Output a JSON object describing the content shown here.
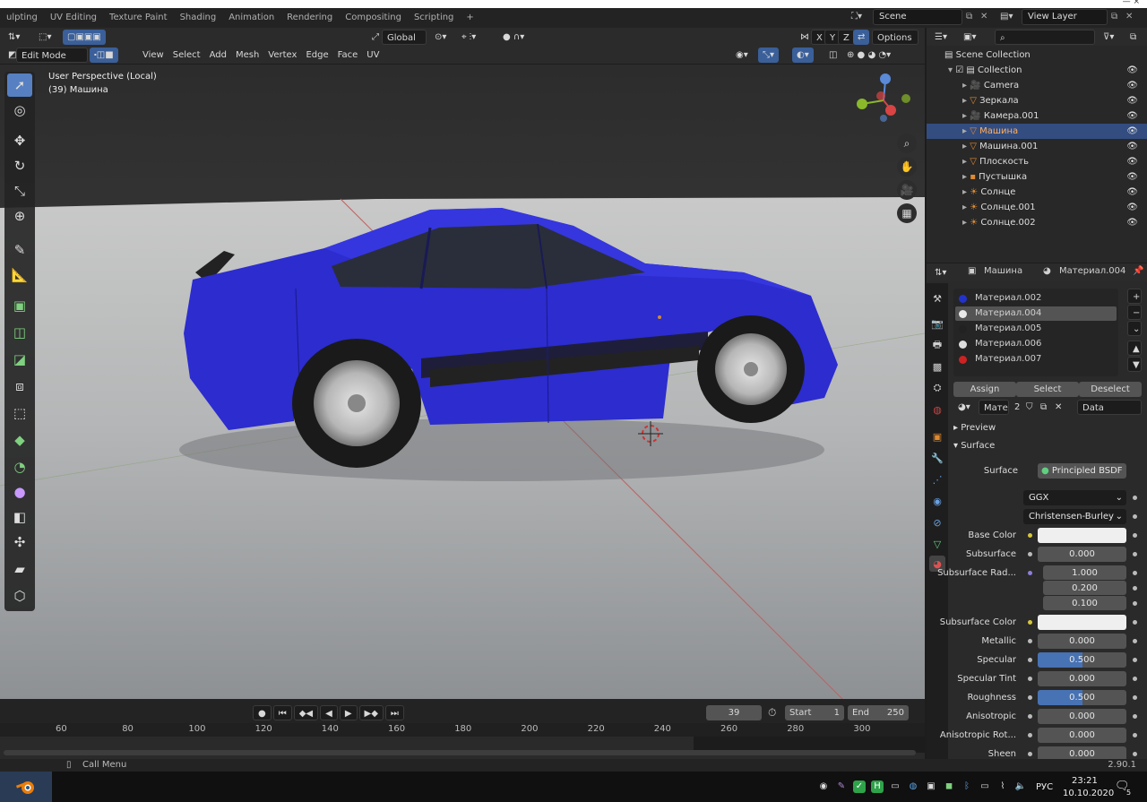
{
  "workspace_tabs": [
    "ulpting",
    "UV Editing",
    "Texture Paint",
    "Shading",
    "Animation",
    "Rendering",
    "Compositing",
    "Scripting",
    "+"
  ],
  "scene": {
    "label": "Scene",
    "view_layer": "View Layer"
  },
  "header": {
    "orientation": "Global",
    "options": "Options",
    "mode": "Edit Mode",
    "menus": [
      "View",
      "Select",
      "Add",
      "Mesh",
      "Vertex",
      "Edge",
      "Face",
      "UV"
    ],
    "axes": [
      "X",
      "Y",
      "Z"
    ]
  },
  "viewport": {
    "line1": "User Perspective (Local)",
    "line2": "(39) Машина"
  },
  "outliner": {
    "root": "Scene Collection",
    "collection": "Collection",
    "items": [
      "Camera",
      "Зеркала",
      "Камера.001",
      "Машина",
      "Машина.001",
      "Плоскость",
      "Пустышка",
      "Солнце",
      "Солнце.001",
      "Солнце.002"
    ],
    "selected": "Машина"
  },
  "properties": {
    "object": "Машина",
    "material": "Материал.004",
    "slots": [
      "Материал.002",
      "Материал.004",
      "Материал.005",
      "Материал.006",
      "Материал.007"
    ],
    "slot_colors": [
      "#2233cc",
      "#e8e8e8",
      "#222222",
      "#dddddd",
      "#cc2222"
    ],
    "assign": "Assign",
    "select": "Select",
    "deselect": "Deselect",
    "mat_short": "Мате",
    "users": "2",
    "data": "Data",
    "preview": "Preview",
    "surface_panel": "Surface",
    "surface_label": "Surface",
    "surface_value": "Principled BSDF",
    "distribution": "GGX",
    "sss_method": "Christensen-Burley",
    "rows": [
      {
        "label": "Base Color",
        "value": "",
        "type": "color"
      },
      {
        "label": "Subsurface",
        "value": "0.000",
        "type": "num"
      },
      {
        "label": "Subsurface Rad...",
        "value": "1.000",
        "type": "num"
      },
      {
        "label": "",
        "value": "0.200",
        "type": "num"
      },
      {
        "label": "",
        "value": "0.100",
        "type": "num"
      },
      {
        "label": "Subsurface Color",
        "value": "",
        "type": "color"
      },
      {
        "label": "Metallic",
        "value": "0.000",
        "type": "num"
      },
      {
        "label": "Specular",
        "value": "0.500",
        "type": "bar",
        "fill": 0.5
      },
      {
        "label": "Specular Tint",
        "value": "0.000",
        "type": "num"
      },
      {
        "label": "Roughness",
        "value": "0.500",
        "type": "bar",
        "fill": 0.5
      },
      {
        "label": "Anisotropic",
        "value": "0.000",
        "type": "num"
      },
      {
        "label": "Anisotropic Rot...",
        "value": "0.000",
        "type": "num"
      },
      {
        "label": "Sheen",
        "value": "0.000",
        "type": "num"
      }
    ]
  },
  "timeline": {
    "frame": "39",
    "start_label": "Start",
    "start": "1",
    "end_label": "End",
    "end": "250",
    "ticks": [
      "60",
      "80",
      "100",
      "120",
      "140",
      "160",
      "180",
      "200",
      "220",
      "240",
      "260",
      "280",
      "300"
    ]
  },
  "status": {
    "left": "Call Menu",
    "version": "2.90.1"
  },
  "taskbar": {
    "lang": "РУС",
    "time": "23:21",
    "date": "10.10.2020",
    "notif": "5"
  }
}
